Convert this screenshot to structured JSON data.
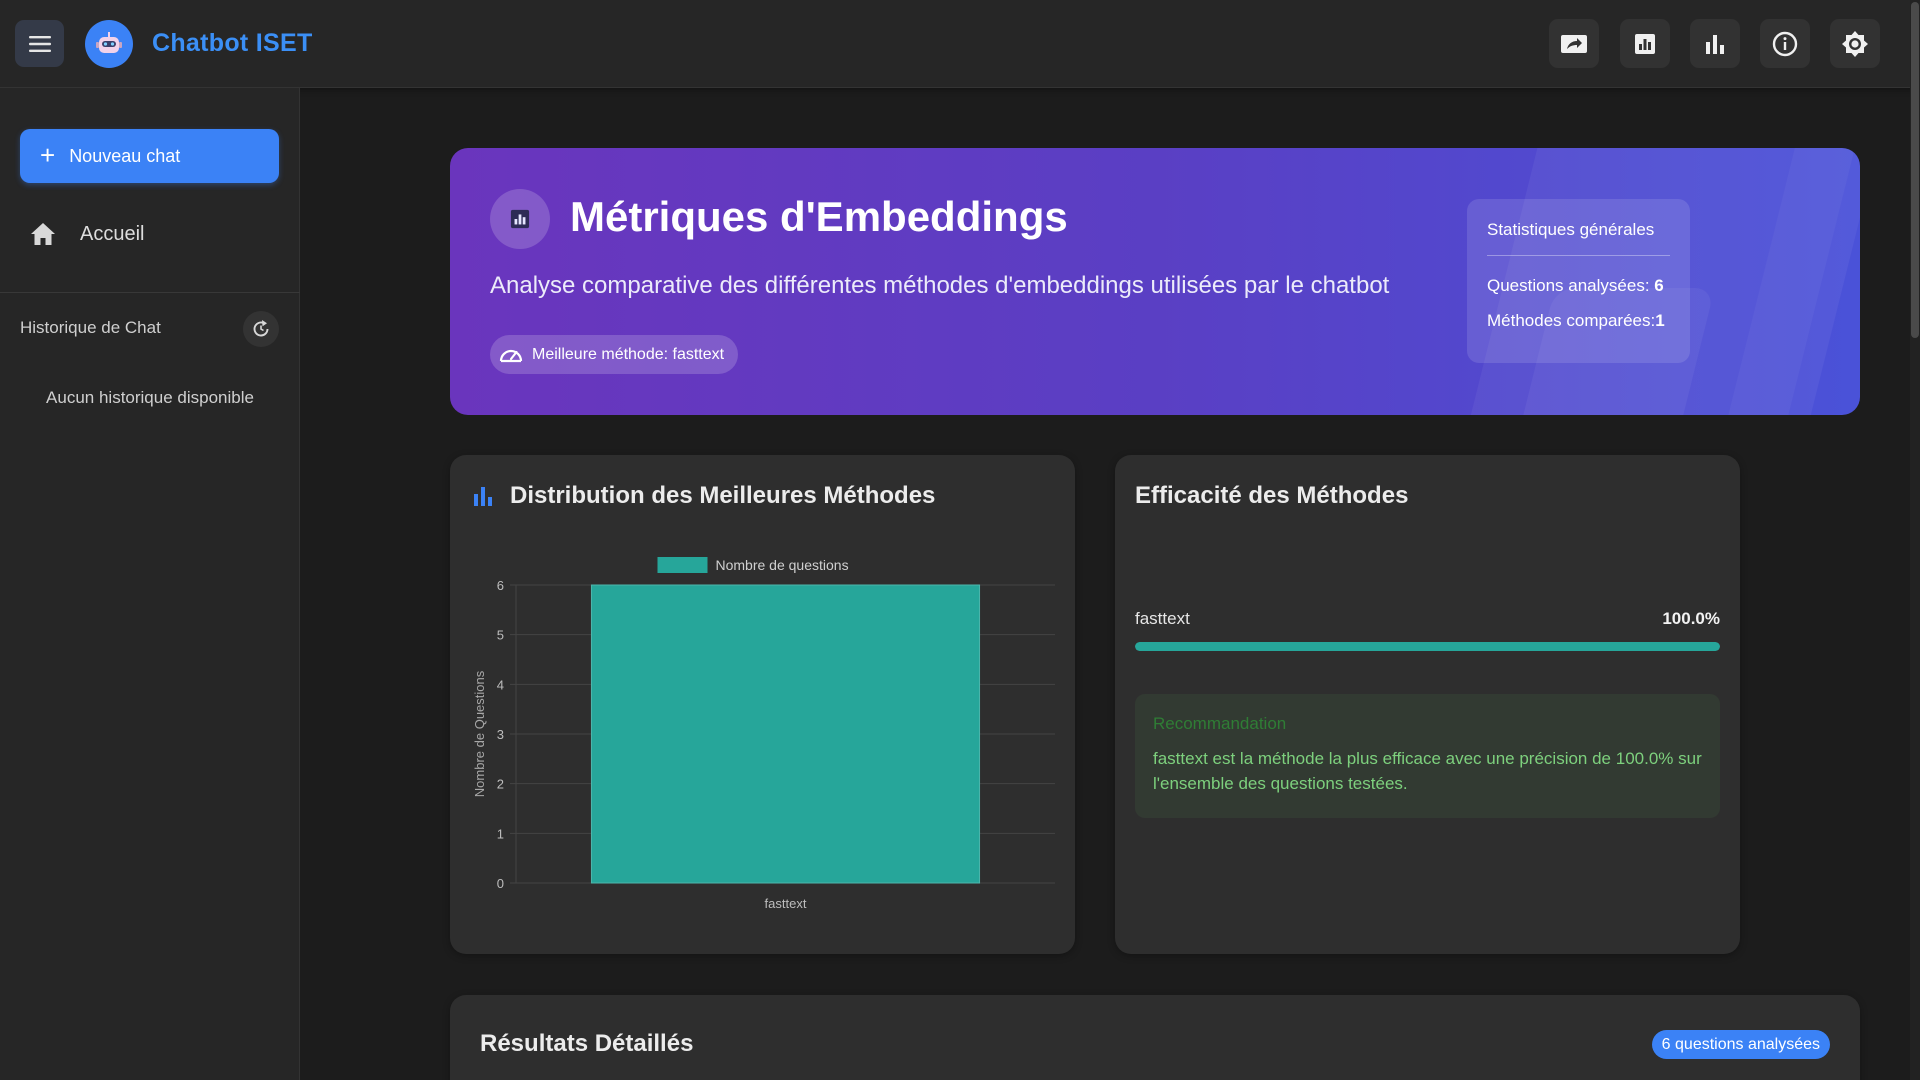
{
  "app": {
    "title": "Chatbot ISET"
  },
  "topbar": {
    "icons": [
      "menu-icon",
      "robot-icon",
      "share-icon",
      "report-icon",
      "bar-chart-icon",
      "info-icon",
      "brightness-icon"
    ]
  },
  "sidebar": {
    "new_chat_label": "Nouveau chat",
    "home_label": "Accueil",
    "history_label": "Historique de Chat",
    "empty_history": "Aucun historique disponible"
  },
  "hero": {
    "title": "Métriques d'Embeddings",
    "subtitle": "Analyse comparative des différentes méthodes d'embeddings utilisées par le chatbot",
    "best_method": "Meilleure méthode: fasttext",
    "stats": {
      "title": "Statistiques générales",
      "questions_label": "Questions analysées: ",
      "questions_value": "6",
      "methods_label": "Méthodes comparées:",
      "methods_value": "1"
    }
  },
  "distribution": {
    "title": "Distribution des Meilleures Méthodes"
  },
  "chart_data": {
    "type": "bar",
    "categories": [
      "fasttext"
    ],
    "series": [
      {
        "name": "Nombre de questions",
        "values": [
          6
        ],
        "color": "#26a69a"
      }
    ],
    "xlabel": "",
    "ylabel": "Nombre de Questions",
    "ylim": [
      0,
      6
    ],
    "yticks": [
      0,
      1,
      2,
      3,
      4,
      5,
      6
    ],
    "grid": true,
    "legend": "top-center"
  },
  "efficiency": {
    "title": "Efficacité des Méthodes",
    "methods": [
      {
        "name": "fasttext",
        "percent_label": "100.0%",
        "fraction": 1.0
      }
    ],
    "recommendation_title": "Recommandation",
    "recommendation_text": "fasttext est la méthode la plus efficace avec une précision de 100.0% sur l'ensemble des questions testées."
  },
  "results": {
    "title": "Résultats Détaillés",
    "badge": "6 questions analysées"
  },
  "colors": {
    "accent": "#3b82f6",
    "bar": "#26a69a",
    "hero_start": "#6a35bd",
    "hero_end": "#4a52d8",
    "recommendation_text": "#7dd07d"
  }
}
